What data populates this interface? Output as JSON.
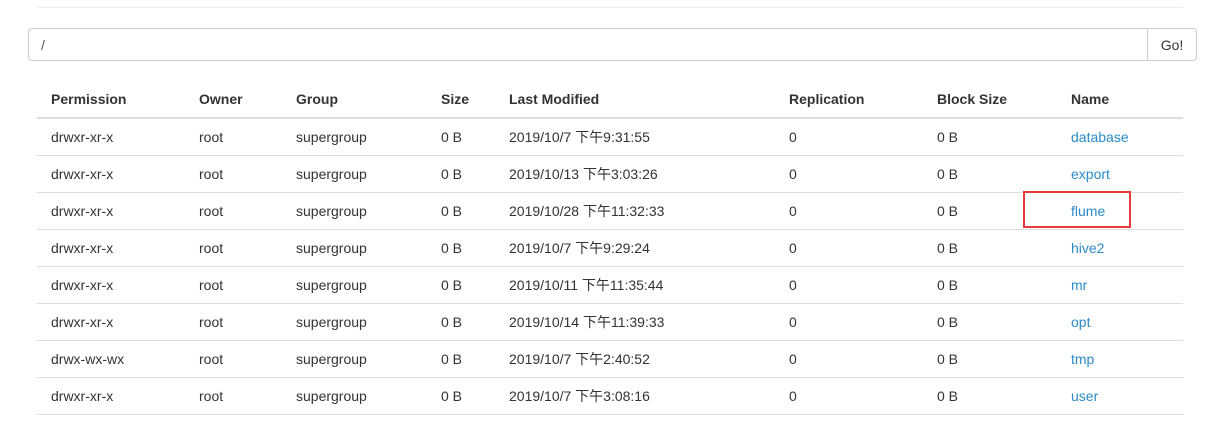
{
  "search": {
    "value": "/",
    "go_label": "Go!"
  },
  "table": {
    "headers": [
      "Permission",
      "Owner",
      "Group",
      "Size",
      "Last Modified",
      "Replication",
      "Block Size",
      "Name"
    ],
    "rows": [
      [
        "drwxr-xr-x",
        "root",
        "supergroup",
        "0 B",
        "2019/10/7 下午9:31:55",
        "0",
        "0 B",
        "database"
      ],
      [
        "drwxr-xr-x",
        "root",
        "supergroup",
        "0 B",
        "2019/10/13 下午3:03:26",
        "0",
        "0 B",
        "export"
      ],
      [
        "drwxr-xr-x",
        "root",
        "supergroup",
        "0 B",
        "2019/10/28 下午11:32:33",
        "0",
        "0 B",
        "flume"
      ],
      [
        "drwxr-xr-x",
        "root",
        "supergroup",
        "0 B",
        "2019/10/7 下午9:29:24",
        "0",
        "0 B",
        "hive2"
      ],
      [
        "drwxr-xr-x",
        "root",
        "supergroup",
        "0 B",
        "2019/10/11 下午11:35:44",
        "0",
        "0 B",
        "mr"
      ],
      [
        "drwxr-xr-x",
        "root",
        "supergroup",
        "0 B",
        "2019/10/14 下午11:39:33",
        "0",
        "0 B",
        "opt"
      ],
      [
        "drwx-wx-wx",
        "root",
        "supergroup",
        "0 B",
        "2019/10/7 下午2:40:52",
        "0",
        "0 B",
        "tmp"
      ],
      [
        "drwxr-xr-x",
        "root",
        "supergroup",
        "0 B",
        "2019/10/7 下午3:08:16",
        "0",
        "0 B",
        "user"
      ]
    ]
  },
  "highlight_color": "#e83a3a",
  "link_color": "#2a8bc8"
}
